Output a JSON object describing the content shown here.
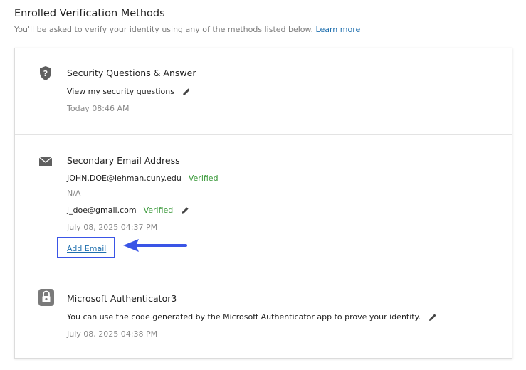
{
  "header": {
    "title": "Enrolled Verification Methods",
    "subtitle": "You'll be asked to verify your identity using any of the methods listed below.",
    "learn_more": "Learn more"
  },
  "methods": {
    "security_questions": {
      "heading": "Security Questions & Answer",
      "action_label": "View my security questions",
      "timestamp": "Today 08:46 AM",
      "icon": "shield-question-icon"
    },
    "secondary_email": {
      "heading": "Secondary Email Address",
      "primary_email": "JOHN.DOE@lehman.cuny.edu",
      "primary_status": "Verified",
      "na_text": "N/A",
      "secondary_email": "j_doe@gmail.com",
      "secondary_status": "Verified",
      "timestamp": "July 08, 2025 04:37 PM",
      "add_email_label": "Add Email",
      "icon": "envelope-icon"
    },
    "authenticator": {
      "heading": "Microsoft Authenticator3",
      "description": "You can use the code generated by the Microsoft Authenticator app to prove your identity.",
      "timestamp": "July 08, 2025 04:38 PM",
      "icon": "authenticator-lock-icon"
    }
  },
  "colors": {
    "link": "#1f6fae",
    "verified": "#3c9a3c",
    "highlight": "#3a55e6",
    "muted": "#8a8a8a"
  }
}
